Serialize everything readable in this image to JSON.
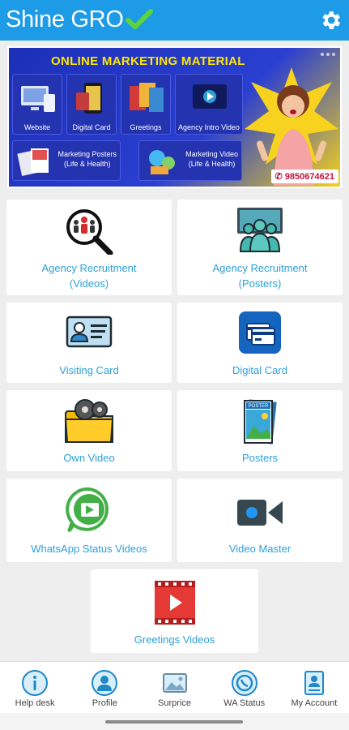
{
  "app": {
    "title": "Shine GRO",
    "title_icon": "check-icon",
    "settings_icon": "gear-icon"
  },
  "banner": {
    "headline": "ONLINE MARKETING MATERIAL",
    "tiles": [
      "Website",
      "Digital Card",
      "Greetings",
      "Agency Intro Video"
    ],
    "wide_tiles": [
      {
        "line1": "Marketing Posters",
        "line2": "(Life & Health)"
      },
      {
        "line1": "Marketing Video",
        "line2": "(Life & Health)"
      }
    ],
    "phone": "9850674621"
  },
  "grid": {
    "agency_videos": {
      "line1": "Agency Recruitment",
      "line2": "(Videos)",
      "icon": "magnifier-people-icon"
    },
    "agency_posters": {
      "line1": "Agency Recruitment",
      "line2": "(Posters)",
      "icon": "team-icon"
    },
    "visiting_card": {
      "label": "Visiting Card",
      "icon": "id-card-icon"
    },
    "digital_card": {
      "label": "Digital Card",
      "icon": "credit-card-icon"
    },
    "own_video": {
      "label": "Own Video",
      "icon": "video-folder-icon"
    },
    "posters": {
      "label": "Posters",
      "icon": "poster-icon"
    },
    "whatsapp_status": {
      "label": "WhatsApp Status Videos",
      "icon": "whatsapp-icon"
    },
    "video_master": {
      "label": "Video Master",
      "icon": "video-camera-icon"
    },
    "greetings_videos": {
      "label": "Greetings Videos",
      "icon": "film-play-icon"
    }
  },
  "bottom_nav": [
    {
      "label": "Help desk",
      "icon": "info-icon"
    },
    {
      "label": "Profile",
      "icon": "user-icon"
    },
    {
      "label": "Surprice",
      "icon": "picture-icon"
    },
    {
      "label": "WA Status",
      "icon": "whatsapp-icon"
    },
    {
      "label": "My Account",
      "icon": "account-card-icon"
    }
  ],
  "colors": {
    "appbar": "#1e9be6",
    "label": "#2f9fd8",
    "background": "#eeeeee"
  }
}
